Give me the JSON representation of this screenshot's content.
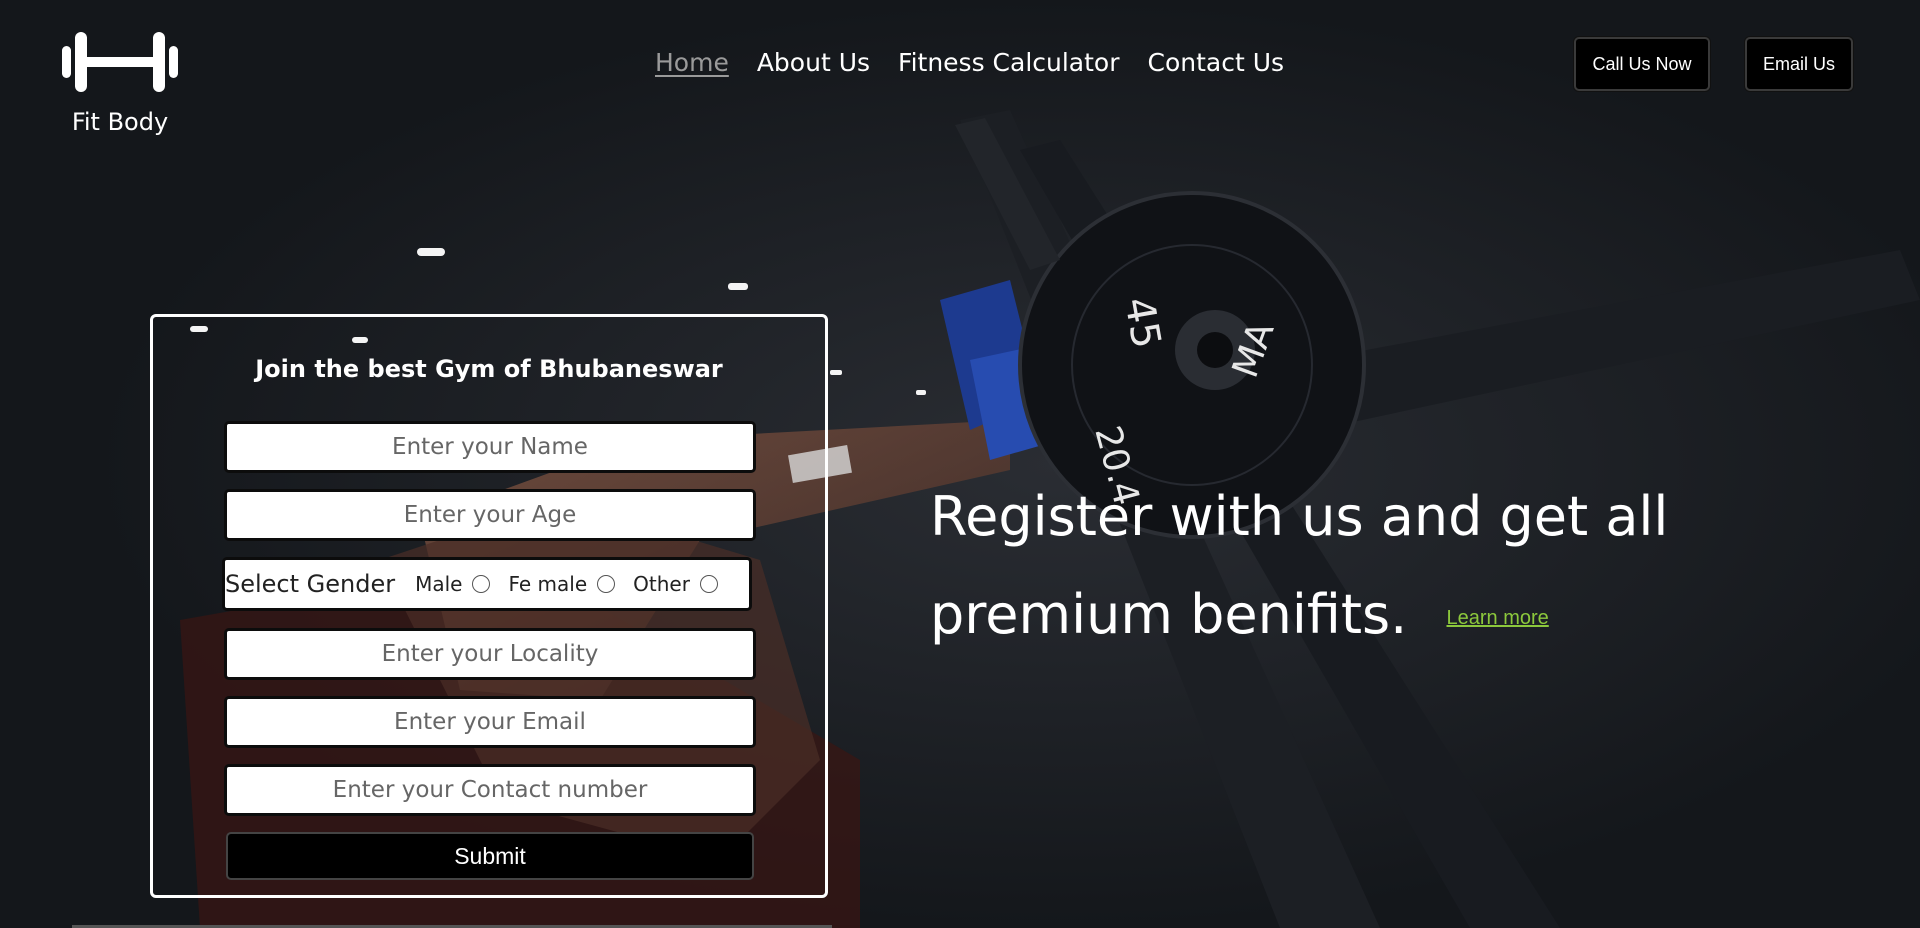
{
  "brand": {
    "name": "Fit Body",
    "logo_icon": "dumbbell-icon"
  },
  "nav": {
    "items": [
      {
        "label": "Home",
        "active": true
      },
      {
        "label": "About Us",
        "active": false
      },
      {
        "label": "Fitness Calculator",
        "active": false
      },
      {
        "label": "Contact Us",
        "active": false
      }
    ]
  },
  "header_buttons": {
    "call": "Call Us Now",
    "email": "Email Us"
  },
  "form": {
    "title": "Join the best Gym of Bhubaneswar",
    "name_placeholder": "Enter your Name",
    "age_placeholder": "Enter your Age",
    "gender_label": "Select Gender",
    "gender_options": [
      "Male",
      "Fe male",
      "Other"
    ],
    "locality_placeholder": "Enter your Locality",
    "email_placeholder": "Enter your Email",
    "contact_placeholder": "Enter your Contact number",
    "submit_label": "Submit"
  },
  "hero": {
    "headline": "Register with us and get all premium benifits.",
    "learn_more": "Learn more"
  },
  "colors": {
    "background": "#14171b",
    "link_accent": "#8cc83c",
    "nav_active": "#9a9a9a"
  }
}
